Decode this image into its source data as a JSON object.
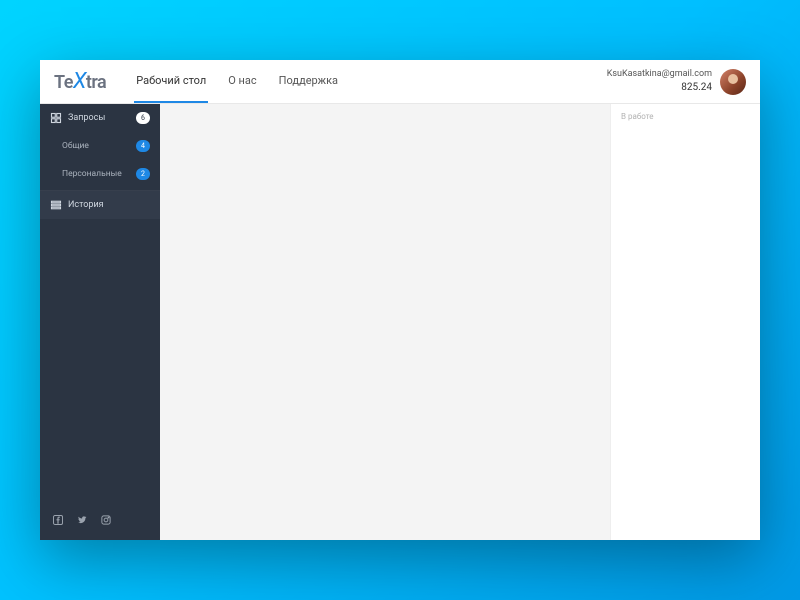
{
  "logo": {
    "part1": "Te",
    "part2": "X",
    "part3": "tra"
  },
  "nav": {
    "desktop": "Рабочий стол",
    "about": "О нас",
    "support": "Поддержка"
  },
  "user": {
    "email": "KsuKasatkina@gmail.com",
    "balance": "825.24"
  },
  "sidebar": {
    "requests": {
      "label": "Запросы",
      "count": "6"
    },
    "common": {
      "label": "Общие",
      "count": "4"
    },
    "personal": {
      "label": "Персональные",
      "count": "2"
    },
    "history": {
      "label": "История"
    }
  },
  "rightpanel": {
    "status": "В работе"
  }
}
